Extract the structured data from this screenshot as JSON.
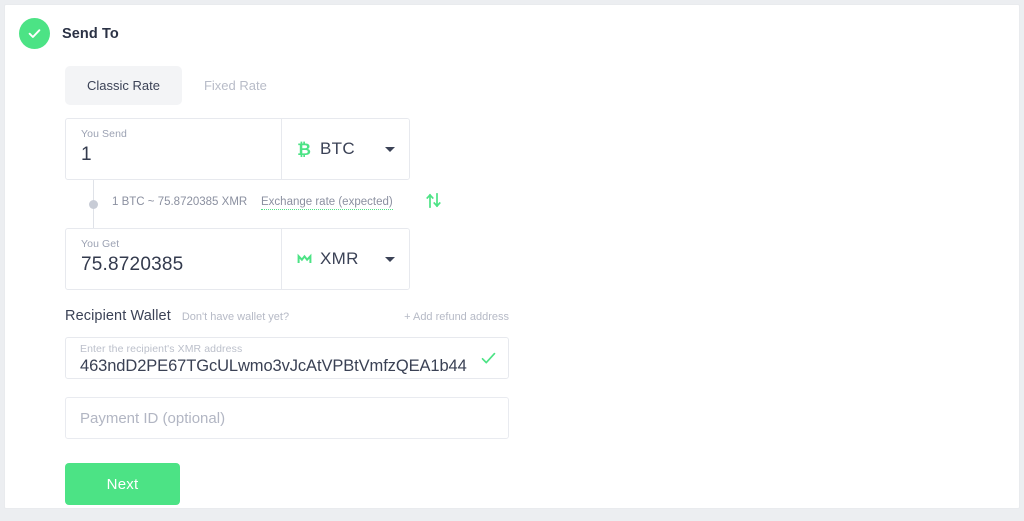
{
  "header": {
    "status_icon": "check-circle-icon",
    "title": "Send To",
    "accent_color": "#4ce385"
  },
  "tabs": [
    {
      "label": "Classic Rate",
      "active": true
    },
    {
      "label": "Fixed Rate",
      "active": false
    }
  ],
  "exchange": {
    "send": {
      "label": "You Send",
      "amount": "1",
      "currency_code": "BTC",
      "currency_icon": "bitcoin-icon"
    },
    "get": {
      "label": "You Get",
      "amount": "75.8720385",
      "currency_code": "XMR",
      "currency_icon": "monero-icon"
    },
    "rate_text": "1 BTC ~ 75.8720385 XMR",
    "rate_link": "Exchange rate (expected)",
    "swap_icon": "swap-vertical-arrows-icon"
  },
  "wallet": {
    "title": "Recipient Wallet",
    "hint": "Don't have wallet yet?",
    "refund_link": "+ Add refund address",
    "address_label": "Enter the recipient's XMR address",
    "address_value": "463ndD2PE67TGcULwmo3vJcAtVPBtVmfzQEA1b44",
    "valid_icon": "green-checkmark-icon",
    "payment_id_placeholder": "Payment ID (optional)",
    "payment_id_value": ""
  },
  "actions": {
    "next_label": "Next"
  }
}
